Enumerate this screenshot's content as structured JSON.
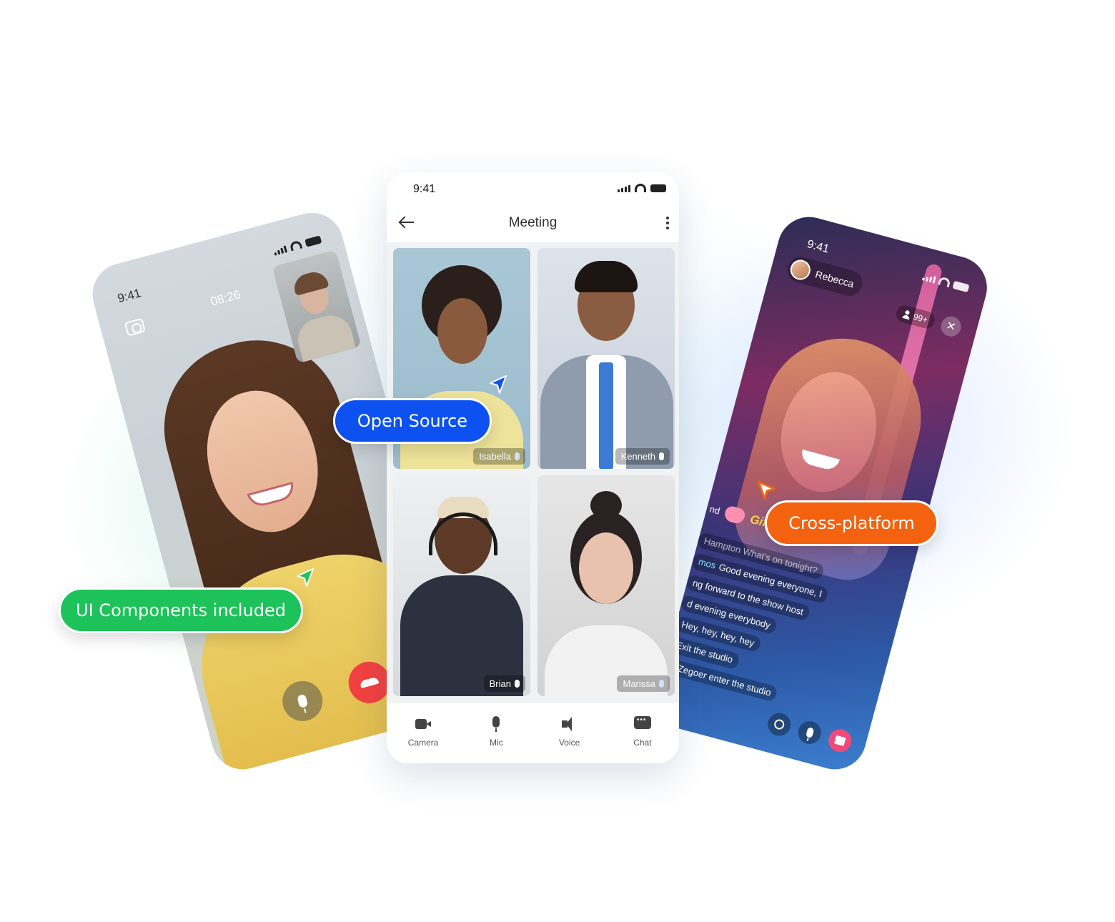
{
  "left_phone": {
    "time": "9:41",
    "call_duration": "08:26"
  },
  "meeting_phone": {
    "time": "9:41",
    "title": "Meeting",
    "participants": [
      {
        "name": "Isabella",
        "mic": "on"
      },
      {
        "name": "Kenneth",
        "mic": "off"
      },
      {
        "name": "Brian",
        "mic": "off"
      },
      {
        "name": "Marissa",
        "mic": "on"
      }
    ],
    "tabs": [
      {
        "label": "Camera",
        "icon": "camera-icon"
      },
      {
        "label": "Mic",
        "icon": "mic-icon"
      },
      {
        "label": "Voice",
        "icon": "speaker-icon"
      },
      {
        "label": "Chat",
        "icon": "chat-icon"
      }
    ]
  },
  "live_phone": {
    "time": "9:41",
    "host_name": "Rebecca",
    "viewer_count": "99+",
    "gift": {
      "sender": "nd",
      "label": "Gift x1"
    },
    "chat": [
      {
        "name": "",
        "text": "Hampton What's on tonight?",
        "muted": true
      },
      {
        "name": "mos",
        "text": "Good evening everyone, I"
      },
      {
        "name": "",
        "text": "ng forward to the  show host"
      },
      {
        "name": "",
        "text": "d evening everybody"
      },
      {
        "name": "",
        "text": "Hey, hey, hey, hey"
      },
      {
        "name": "",
        "text": "Exit the studio"
      },
      {
        "name": "",
        "text": "n Zegoer enter the studio"
      }
    ]
  },
  "badges": {
    "open_source": "Open Source",
    "cross_platform": "Cross-platform",
    "ui_components": "UI Components included"
  },
  "colors": {
    "blue": "#0d52f0",
    "orange": "#f3620e",
    "green": "#1ec25a",
    "hangup_red": "#f24141"
  }
}
